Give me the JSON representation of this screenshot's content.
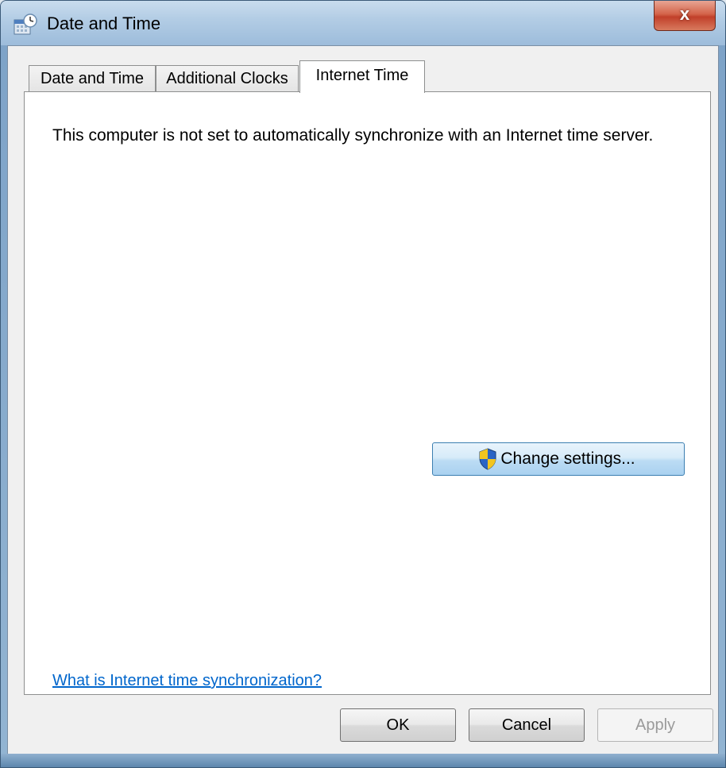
{
  "window": {
    "title": "Date and Time",
    "close_label": "x"
  },
  "tabs": [
    {
      "label": "Date and Time",
      "selected": false
    },
    {
      "label": "Additional Clocks",
      "selected": false
    },
    {
      "label": "Internet Time",
      "selected": true
    }
  ],
  "panel": {
    "description": "This computer is not set to automatically synchronize with an Internet time server.",
    "change_settings_label": "Change settings...",
    "help_link": "What is Internet time synchronization?"
  },
  "buttons": {
    "ok": "OK",
    "cancel": "Cancel",
    "apply": "Apply",
    "apply_enabled": false
  },
  "colors": {
    "link": "#0066cc",
    "close_button": "#c1402a",
    "shield_blue": "#2a64c5",
    "shield_yellow": "#f2c51f"
  },
  "icons": {
    "title": "date-time-icon",
    "uac": "uac-shield-icon"
  }
}
